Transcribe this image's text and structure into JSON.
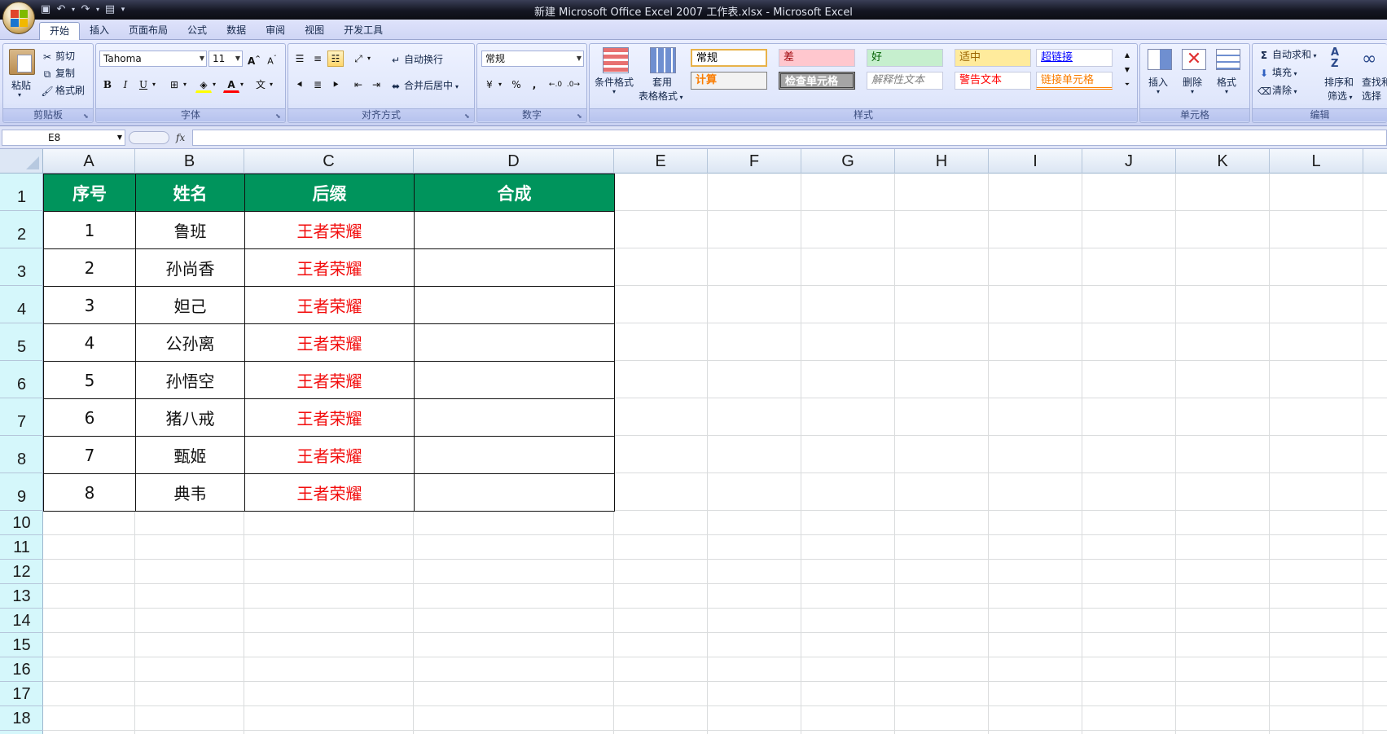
{
  "window": {
    "title": "新建 Microsoft Office Excel 2007 工作表.xlsx - Microsoft Excel"
  },
  "ribbon_tabs": [
    "开始",
    "插入",
    "页面布局",
    "公式",
    "数据",
    "审阅",
    "视图",
    "开发工具"
  ],
  "clipboard": {
    "paste": "粘贴",
    "cut": "剪切",
    "copy": "复制",
    "format_painter": "格式刷",
    "label": "剪贴板"
  },
  "font": {
    "name": "Tahoma",
    "size": "11",
    "bold": "B",
    "italic": "I",
    "underline": "U",
    "label": "字体"
  },
  "alignment": {
    "wrap": "自动换行",
    "merge": "合并后居中",
    "label": "对齐方式"
  },
  "number": {
    "format": "常规",
    "percent": "%",
    "comma": ",",
    "label": "数字"
  },
  "styles": {
    "conditional": "条件格式",
    "table_format_line1": "套用",
    "table_format_line2": "表格格式",
    "gallery": [
      {
        "text": "常规",
        "bg": "#ffffff",
        "fg": "#000000"
      },
      {
        "text": "差",
        "bg": "#ffc7ce",
        "fg": "#9c0006"
      },
      {
        "text": "好",
        "bg": "#c6efce",
        "fg": "#006100"
      },
      {
        "text": "适中",
        "bg": "#ffeb9c",
        "fg": "#9c6500"
      },
      {
        "text": "超链接",
        "bg": "#ffffff",
        "fg": "#0000ff"
      },
      {
        "text": "计算",
        "bg": "#f2f2f2",
        "fg": "#fa7d00"
      },
      {
        "text": "检查单元格",
        "bg": "#a5a5a5",
        "fg": "#ffffff"
      },
      {
        "text": "解释性文本",
        "bg": "#ffffff",
        "fg": "#7f7f7f"
      },
      {
        "text": "警告文本",
        "bg": "#ffffff",
        "fg": "#ff0000"
      },
      {
        "text": "链接单元格",
        "bg": "#ffffff",
        "fg": "#fa7d00"
      }
    ],
    "label": "样式"
  },
  "cells_group": {
    "insert": "插入",
    "delete": "删除",
    "format": "格式",
    "label": "单元格"
  },
  "editing": {
    "autosum": "自动求和",
    "fill": "填充",
    "clear": "清除",
    "sort_line1": "排序和",
    "sort_line2": "筛选",
    "find_line1": "查找和",
    "find_line2": "选择",
    "label": "编辑"
  },
  "formula_bar": {
    "name_box": "E8",
    "fx": "fx",
    "content": ""
  },
  "columns": [
    "A",
    "B",
    "C",
    "D",
    "E",
    "F",
    "G",
    "H",
    "I",
    "J",
    "K",
    "L"
  ],
  "rows": [
    "1",
    "2",
    "3",
    "4",
    "5",
    "6",
    "7",
    "8",
    "9",
    "10",
    "11",
    "12",
    "13",
    "14",
    "15",
    "16",
    "17",
    "18"
  ],
  "sheet": {
    "headers": [
      "序号",
      "姓名",
      "后缀",
      "合成"
    ],
    "rows": [
      [
        "1",
        "鲁班",
        "王者荣耀",
        ""
      ],
      [
        "2",
        "孙尚香",
        "王者荣耀",
        ""
      ],
      [
        "3",
        "妲己",
        "王者荣耀",
        ""
      ],
      [
        "4",
        "公孙离",
        "王者荣耀",
        ""
      ],
      [
        "5",
        "孙悟空",
        "王者荣耀",
        ""
      ],
      [
        "6",
        "猪八戒",
        "王者荣耀",
        ""
      ],
      [
        "7",
        "甄姬",
        "王者荣耀",
        ""
      ],
      [
        "8",
        "典韦",
        "王者荣耀",
        ""
      ]
    ]
  },
  "colors": {
    "header_fill": "#00945c",
    "suffix_text": "#f20d0d",
    "row_header_bg": "#d5f7fb"
  }
}
